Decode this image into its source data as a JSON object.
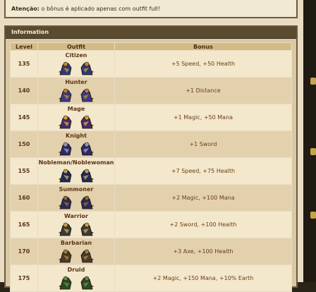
{
  "alert": {
    "label": "Atenção:",
    "text": "o bônus é aplicado apenas com outfit full!"
  },
  "panel": {
    "title": "Information"
  },
  "table": {
    "headers": [
      "Level",
      "Outfit",
      "Bonus"
    ],
    "rows": [
      {
        "level": "135",
        "outfit": "Citizen",
        "bonus": "+5 Speed, +50 Health"
      },
      {
        "level": "140",
        "outfit": "Hunter",
        "bonus": "+1 Distance"
      },
      {
        "level": "145",
        "outfit": "Mage",
        "bonus": "+1 Magic, +50 Mana"
      },
      {
        "level": "150",
        "outfit": "Knight",
        "bonus": "+1 Sword"
      },
      {
        "level": "155",
        "outfit": "Nobleman/Noblewoman",
        "bonus": "+7 Speed, +75 Health"
      },
      {
        "level": "160",
        "outfit": "Summoner",
        "bonus": "+2 Magic, +100 Mana"
      },
      {
        "level": "165",
        "outfit": "Warrior",
        "bonus": "+2 Sword, +100 Health"
      },
      {
        "level": "170",
        "outfit": "Barbarian",
        "bonus": "+3 Axe, +100 Health"
      },
      {
        "level": "175",
        "outfit": "Druid",
        "bonus": "+2 Magic, +150 Mana, +10% Earth"
      }
    ]
  },
  "colors": {
    "header_bar": "#5a4a30",
    "row_light": "#f3e7cc",
    "row_dark": "#e3d1ae"
  }
}
